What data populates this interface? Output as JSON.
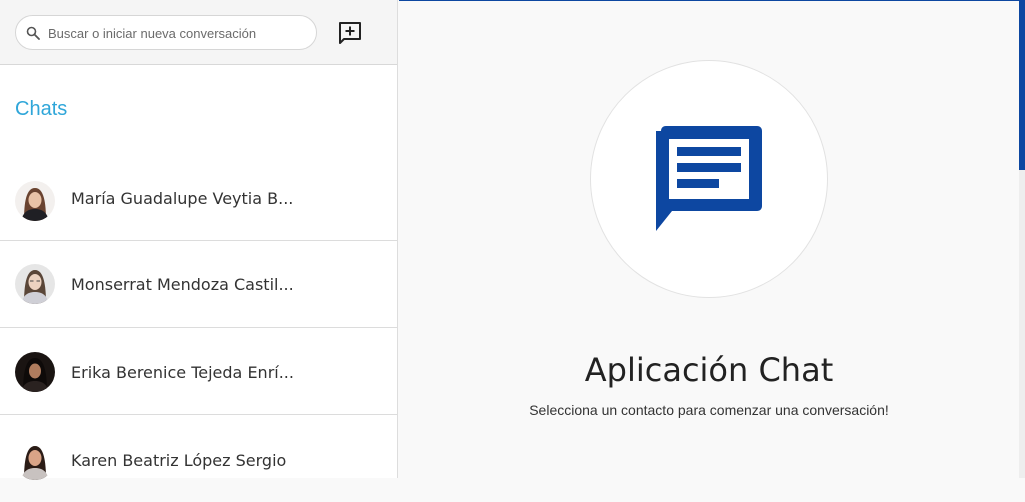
{
  "search": {
    "placeholder": "Buscar o iniciar nueva conversación"
  },
  "sidebar": {
    "title": "Chats",
    "contacts": [
      {
        "name": "María Guadalupe Veytia B...",
        "avatar": "woman-avatar"
      },
      {
        "name": "Monserrat Mendoza Castil...",
        "avatar": "woman-avatar"
      },
      {
        "name": "Erika Berenice Tejeda Enrí...",
        "avatar": "woman-avatar"
      },
      {
        "name": "Karen Beatriz López Sergio",
        "avatar": "woman-avatar"
      }
    ]
  },
  "main": {
    "title": "Aplicación Chat",
    "subtitle": "Selecciona un contacto para comenzar una conversación!"
  },
  "colors": {
    "accent": "#2fa6d9",
    "brand": "#0d47a1"
  }
}
